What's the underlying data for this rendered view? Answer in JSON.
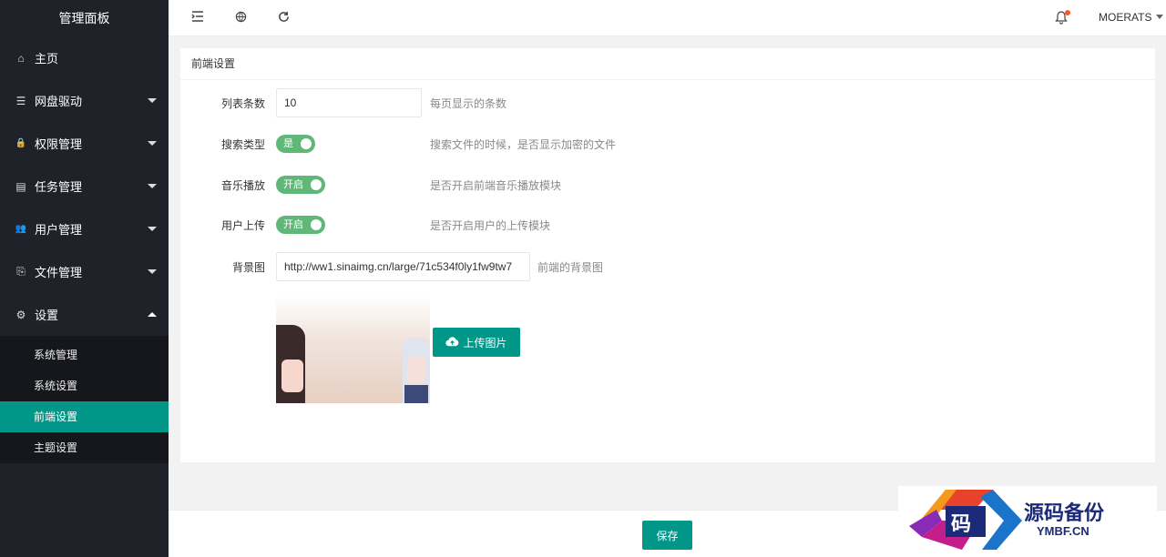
{
  "sidebar": {
    "title": "管理面板",
    "items": [
      {
        "label": "主页",
        "icon": "⌂"
      },
      {
        "label": "网盘驱动",
        "icon": "☰"
      },
      {
        "label": "权限管理",
        "icon": "🔒"
      },
      {
        "label": "任务管理",
        "icon": "▤"
      },
      {
        "label": "用户管理",
        "icon": "👥"
      },
      {
        "label": "文件管理",
        "icon": "⎘"
      },
      {
        "label": "设置",
        "icon": "⚙"
      }
    ],
    "sub_items": [
      "系统管理",
      "系统设置",
      "前端设置",
      "主题设置"
    ],
    "active_sub": "前端设置"
  },
  "header": {
    "icons": [
      "menu-collapse-icon",
      "globe-icon",
      "refresh-icon",
      "bell-icon"
    ],
    "user": "MOERATS"
  },
  "card": {
    "title": "前端设置",
    "fields": {
      "page_size": {
        "label": "列表条数",
        "value": "10",
        "hint": "每页显示的条数"
      },
      "search_type": {
        "label": "搜索类型",
        "switch": "是",
        "hint": "搜索文件的时候，是否显示加密的文件"
      },
      "music": {
        "label": "音乐播放",
        "switch": "开启",
        "hint": "是否开启前端音乐播放模块"
      },
      "upload": {
        "label": "用户上传",
        "switch": "开启",
        "hint": "是否开启用户的上传模块"
      },
      "background": {
        "label": "背景图",
        "value": "http://ww1.sinaimg.cn/large/71c534f0ly1fw9tw7",
        "hint": "前端的背景图"
      }
    },
    "upload_button": "上传图片"
  },
  "footer": {
    "save": "保存"
  },
  "watermark": {
    "logo_char": "码",
    "text": "源码备份",
    "sub": "YMBF.CN"
  },
  "colors": {
    "accent": "#009688",
    "sidebar": "#20222a",
    "switch_on": "#5fb878"
  }
}
